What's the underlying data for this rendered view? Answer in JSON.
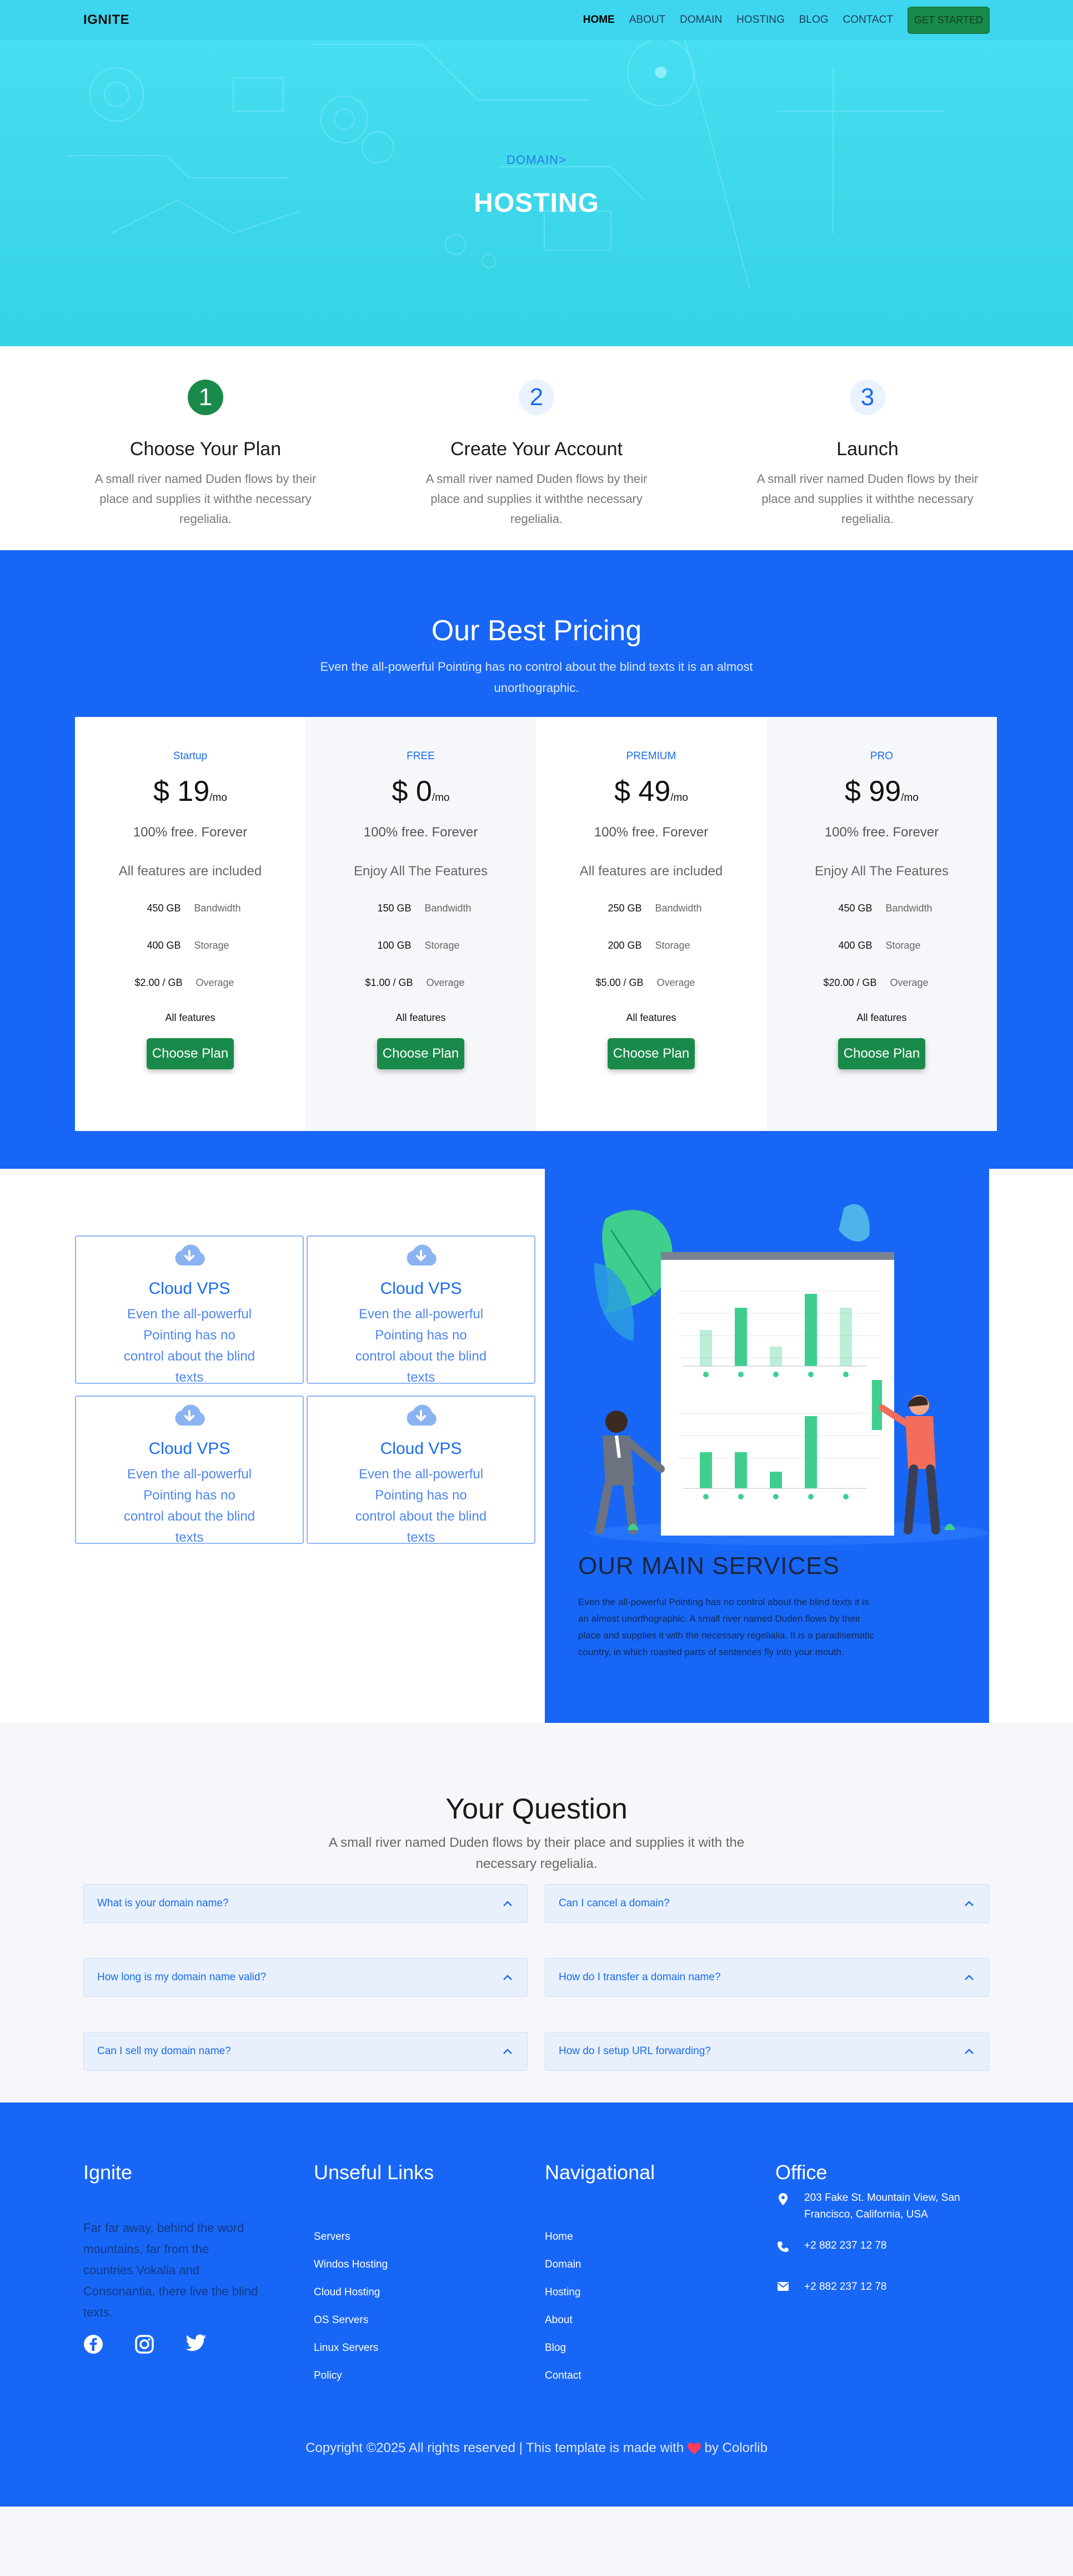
{
  "nav": {
    "brand": "IGNITE",
    "links": [
      "HOME",
      "ABOUT",
      "DOMAIN",
      "HOSTING",
      "BLOG",
      "CONTACT"
    ],
    "cta": "GET STARTED"
  },
  "hero": {
    "breadcrumb": "DOMAIN>",
    "title": "HOSTING"
  },
  "steps": [
    {
      "num": "1",
      "title": "Choose Your Plan",
      "desc": "A small river named Duden flows by their place and supplies it withthe necessary regelialia."
    },
    {
      "num": "2",
      "title": "Create Your Account",
      "desc": "A small river named Duden flows by their place and supplies it withthe necessary regelialia."
    },
    {
      "num": "3",
      "title": "Launch",
      "desc": "A small river named Duden flows by their place and supplies it withthe necessary regelialia."
    }
  ],
  "pricing": {
    "title": "Our Best Pricing",
    "subtitle": "Even the all-powerful Pointing has no control about the blind texts it is an almost unorthographic.",
    "plans": [
      {
        "name": "Startup",
        "price": "$ 19",
        "unit": "/mo",
        "free": "100% free. Forever",
        "features": "All features are included",
        "bandwidth": "450 GB",
        "storage": "400 GB",
        "overage": "$2.00 /  GB",
        "all": "All features",
        "button": "Choose Plan"
      },
      {
        "name": "FREE",
        "price": "$ 0",
        "unit": "/mo",
        "free": "100% free. Forever",
        "features": "Enjoy All The Features",
        "bandwidth": "150 GB",
        "storage": "100 GB",
        "overage": "$1.00 /  GB",
        "all": "All features",
        "button": "Choose Plan"
      },
      {
        "name": "PREMIUM",
        "price": "$ 49",
        "unit": "/mo",
        "free": "100% free. Forever",
        "features": "All features are included",
        "bandwidth": "250 GB",
        "storage": "200 GB",
        "overage": "$5.00 /  GB",
        "all": "All features",
        "button": "Choose Plan"
      },
      {
        "name": "PRO",
        "price": "$ 99",
        "unit": "/mo",
        "free": "100% free. Forever",
        "features": "Enjoy All The Features",
        "bandwidth": "450 GB",
        "storage": "400 GB",
        "overage": "$20.00 / GB",
        "all": "All features",
        "button": "Choose Plan"
      }
    ],
    "labels": {
      "bandwidth": "Bandwidth",
      "storage": "Storage",
      "overage": "Overage"
    }
  },
  "services": {
    "cards": [
      {
        "title": "Cloud VPS",
        "desc": "Even the all-powerful Pointing has no control about the blind texts"
      },
      {
        "title": "Cloud VPS",
        "desc": "Even the all-powerful Pointing has no control about the blind texts"
      },
      {
        "title": "Cloud VPS",
        "desc": "Even the all-powerful Pointing has no control about the blind texts"
      },
      {
        "title": "Cloud VPS",
        "desc": "Even the all-powerful Pointing has no control about the blind texts"
      }
    ],
    "heading": "OUR MAIN SERVICES",
    "text": "Even the all-powerful Pointing has no control about the blind texts it is an almost unorthographic. A small river named Duden flows by their place and supplies it with the necessary regelialia. It is a paradisematic country, in which roasted parts of sentences fly into your mouth."
  },
  "faq": {
    "title": "Your Question",
    "subtitle": "A small river named Duden flows by their place and supplies it with the necessary regelialia.",
    "items": [
      "What is your domain name?",
      "Can I cancel a domain?",
      "How long is my domain name valid?",
      "How do I transfer a domain name?",
      "Can I sell my domain name?",
      "How do I setup URL forwarding?"
    ]
  },
  "footer": {
    "brand": "Ignite",
    "about": "Far far away, behind the word mountains, far from the countries Vokalia and Consonantia, there live the blind texts.",
    "useful_title": "Unseful Links",
    "useful": [
      "Servers",
      "Windos Hosting",
      "Cloud Hosting",
      "OS Servers",
      "Linux Servers",
      "Policy"
    ],
    "nav_title": "Navigational",
    "nav": [
      "Home",
      "Domain",
      "Hosting",
      "About",
      "Blog",
      "Contact"
    ],
    "office_title": "Office",
    "address": "203 Fake St. Mountain View, San Francisco, California, USA",
    "phone1": "+2 882 237 12 78",
    "phone2": "+2 882 237 12 78",
    "copyright_pre": "Copyright ©2025 All rights reserved | This template is made with",
    "copyright_post": "by Colorlib",
    "icons": [
      "facebook-icon",
      "instagram-icon",
      "twitter-icon"
    ]
  },
  "colors": {
    "primary": "#1866f5",
    "hero": "#3ed6ee",
    "green": "#1a8a4a"
  }
}
